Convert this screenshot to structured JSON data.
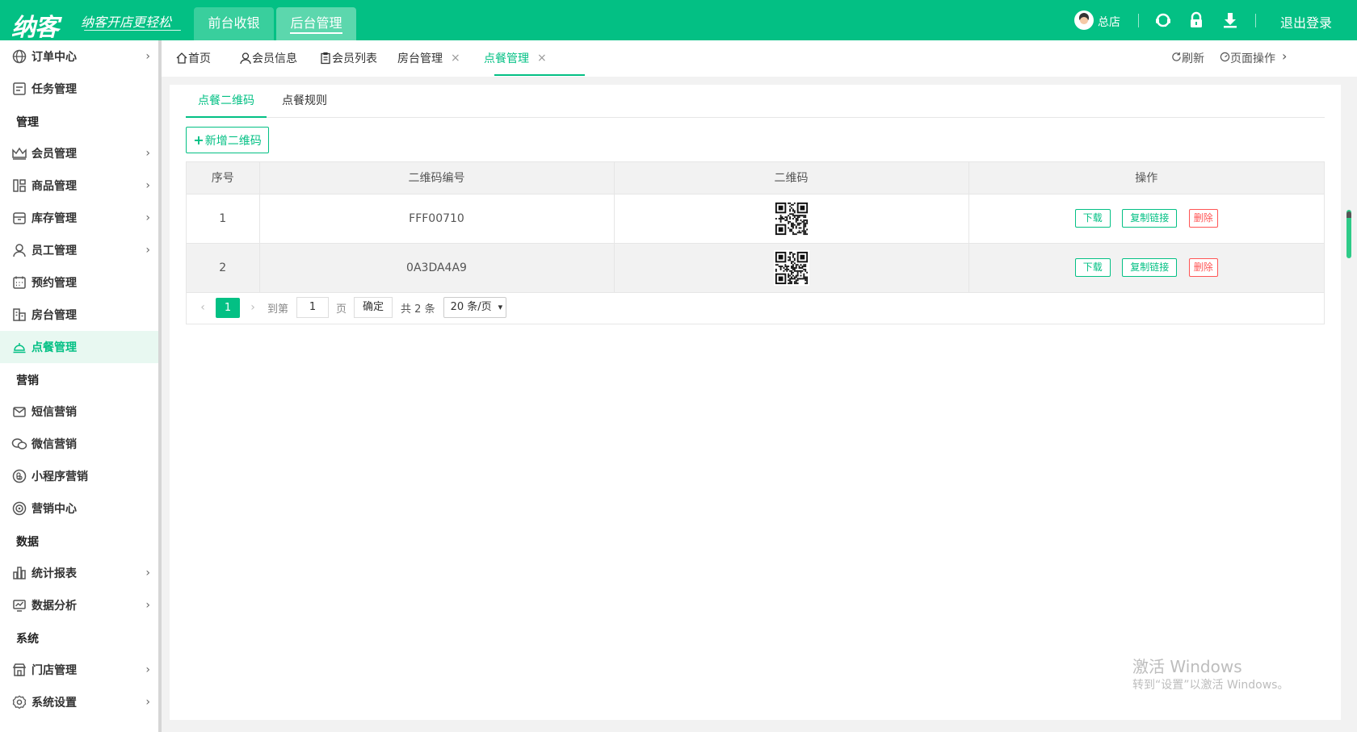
{
  "header": {
    "logo": "纳客",
    "slogan": "纳客开店更轻松",
    "front_tab": "前台收银",
    "back_tab": "后台管理",
    "store": "总店",
    "logout": "退出登录",
    "brand_color": "#03c084"
  },
  "sidebar": {
    "items": [
      {
        "label": "订单中心",
        "icon": "globe-icon",
        "arrow": "›"
      },
      {
        "label": "任务管理",
        "icon": "task-icon",
        "arrow": ""
      },
      {
        "label": "会员管理",
        "icon": "crown-icon",
        "arrow": "›"
      },
      {
        "label": "商品管理",
        "icon": "grid-icon",
        "arrow": "›"
      },
      {
        "label": "库存管理",
        "icon": "box-icon",
        "arrow": "›"
      },
      {
        "label": "员工管理",
        "icon": "user-icon",
        "arrow": "›"
      },
      {
        "label": "预约管理",
        "icon": "calendar-icon",
        "arrow": ""
      },
      {
        "label": "房台管理",
        "icon": "building-icon",
        "arrow": ""
      },
      {
        "label": "点餐管理",
        "icon": "bell-icon",
        "arrow": ""
      },
      {
        "label": "短信营销",
        "icon": "mail-icon",
        "arrow": ""
      },
      {
        "label": "微信营销",
        "icon": "wechat-icon",
        "arrow": ""
      },
      {
        "label": "小程序营销",
        "icon": "miniapp-icon",
        "arrow": ""
      },
      {
        "label": "营销中心",
        "icon": "target-icon",
        "arrow": ""
      },
      {
        "label": "统计报表",
        "icon": "bar-chart-icon",
        "arrow": "›"
      },
      {
        "label": "数据分析",
        "icon": "line-chart-icon",
        "arrow": "›"
      },
      {
        "label": "门店管理",
        "icon": "store-icon",
        "arrow": "›"
      },
      {
        "label": "系统设置",
        "icon": "gear-icon",
        "arrow": "›"
      }
    ],
    "groups": [
      "管理",
      "营销",
      "数据",
      "系统"
    ]
  },
  "tabs": {
    "items": [
      {
        "label": "首页",
        "icon": "home-icon",
        "close": ""
      },
      {
        "label": "会员信息",
        "icon": "user-icon",
        "close": ""
      },
      {
        "label": "会员列表",
        "icon": "clipboard-icon",
        "close": ""
      },
      {
        "label": "房台管理",
        "icon": "",
        "close": "×"
      },
      {
        "label": "点餐管理",
        "icon": "",
        "close": "×"
      }
    ],
    "refresh": "刷新",
    "page_ops": "页面操作",
    "more": "›"
  },
  "subtabs": [
    "点餐二维码",
    "点餐规则"
  ],
  "add_button": "新增二维码",
  "table": {
    "headers": [
      "序号",
      "二维码编号",
      "二维码",
      "操作"
    ],
    "rows": [
      {
        "index": "1",
        "code": "FFF00710"
      },
      {
        "index": "2",
        "code": "0A3DA4A9"
      }
    ],
    "actions": {
      "download": "下载",
      "copy": "复制链接",
      "delete": "删除"
    }
  },
  "pager": {
    "prev": "‹",
    "current": "1",
    "next": "›",
    "goto": "到第",
    "page_value": "1",
    "page_unit": "页",
    "confirm": "确定",
    "total": "共 2 条",
    "page_size": "20 条/页",
    "chevron": "▾"
  },
  "watermark": {
    "line1": "激活 Windows",
    "line2": "转到“设置”以激活 Windows。"
  }
}
